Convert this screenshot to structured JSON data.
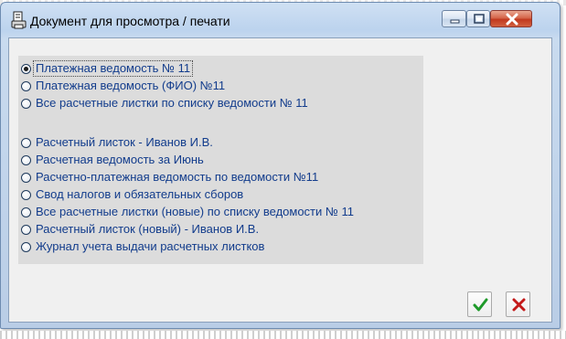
{
  "window": {
    "title": "Документ для  просмотра / печати",
    "icon": "document-print-icon",
    "controls": [
      "minimize-icon",
      "maximize-icon",
      "close-icon"
    ]
  },
  "options": [
    {
      "label": "Платежная ведомость № 11",
      "checked": true
    },
    {
      "label": "Платежная ведомость (ФИО) №11",
      "checked": false
    },
    {
      "label": "Все расчетные листки по списку ведомости № 11",
      "checked": false
    },
    {
      "label": "Расчетный листок - Иванов И.В.",
      "checked": false
    },
    {
      "label": "Расчетная ведомость за Июнь",
      "checked": false
    },
    {
      "label": "Расчетно-платежная ведомость по ведомости №11",
      "checked": false
    },
    {
      "label": "Свод налогов и обязательных сборов",
      "checked": false
    },
    {
      "label": "Все расчетные листки (новые) по списку ведомости № 11",
      "checked": false
    },
    {
      "label": "Расчетный листок (новый) - Иванов И.В.",
      "checked": false
    },
    {
      "label": "Журнал учета выдачи расчетных листков",
      "checked": false
    }
  ],
  "buttons": {
    "ok_icon": "checkmark-icon",
    "cancel_icon": "cross-icon",
    "ok_color": "#1f9a2a",
    "cancel_color": "#c41a1a"
  },
  "colors": {
    "label_text": "#123c8c",
    "panel_bg": "#dcdcdc",
    "client_bg": "#f0f0f0"
  }
}
